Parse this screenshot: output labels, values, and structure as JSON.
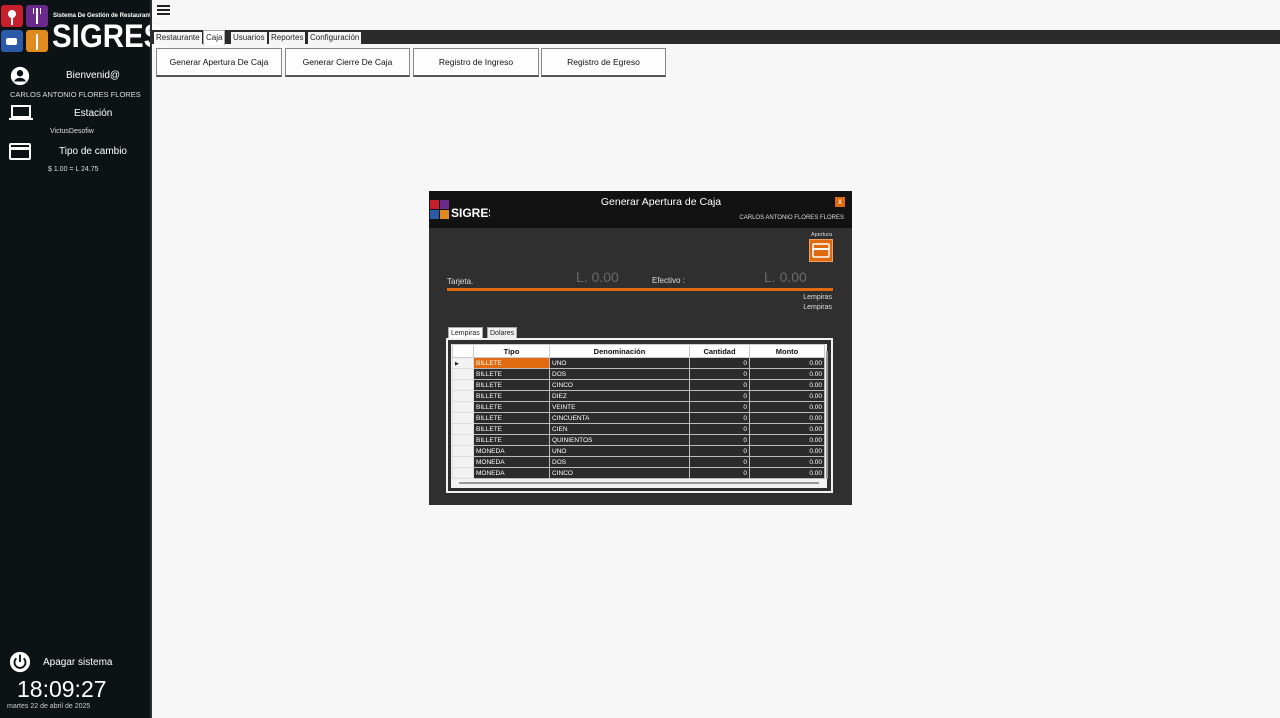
{
  "brand": {
    "name": "SIGRES",
    "tagline": "Sistema De Gestión de Restaurantes"
  },
  "sidebar": {
    "welcome": "Bienvenid@",
    "user": "CARLOS ANTONIO FLORES FLORES",
    "station_label": "Estación",
    "station_value": "VictusDesofiw",
    "exchange_label": "Tipo de cambio",
    "exchange_value": "$ 1.00 = L 24.75",
    "shutdown_label": "Apagar sistema",
    "time": "18:09:27",
    "date": "martes 22 de abril de 2025"
  },
  "menu": {
    "items": [
      "Restaurante",
      "Caja",
      "Usuarios",
      "Reportes",
      "Configuración"
    ],
    "active": "Caja"
  },
  "actions": [
    "Generar Apertura De Caja",
    "Generar Cierre De Caja",
    "Registro de Ingreso",
    "Registro de Egreso"
  ],
  "dialog": {
    "title": "Generar Apertura de Caja",
    "user": "CARLOS ANTONIO FLORES FLORES",
    "close": "x",
    "apertura_label": "Apertura",
    "card_label": "Tarjeta.",
    "card_amount": "L. 0.00",
    "cash_label": "Efectivo :",
    "cash_amount": "L. 0.00",
    "currency_lines": [
      "Lempiras",
      "Lempiras"
    ],
    "tabs": [
      "Lempiras",
      "Dolares"
    ],
    "active_tab": "Lempiras",
    "columns": [
      "Tipo",
      "Denominación",
      "Cantidad",
      "Monto"
    ],
    "rows": [
      {
        "tipo": "BILLETE",
        "denominacion": "UNO",
        "cantidad": "0",
        "monto": "0.00"
      },
      {
        "tipo": "BILLETE",
        "denominacion": "DOS",
        "cantidad": "0",
        "monto": "0.00"
      },
      {
        "tipo": "BILLETE",
        "denominacion": "CINCO",
        "cantidad": "0",
        "monto": "0.00"
      },
      {
        "tipo": "BILLETE",
        "denominacion": "DIEZ",
        "cantidad": "0",
        "monto": "0.00"
      },
      {
        "tipo": "BILLETE",
        "denominacion": "VEINTE",
        "cantidad": "0",
        "monto": "0.00"
      },
      {
        "tipo": "BILLETE",
        "denominacion": "CINCUENTA",
        "cantidad": "0",
        "monto": "0.00"
      },
      {
        "tipo": "BILLETE",
        "denominacion": "CIEN",
        "cantidad": "0",
        "monto": "0.00"
      },
      {
        "tipo": "BILLETE",
        "denominacion": "QUINIENTOS",
        "cantidad": "0",
        "monto": "0.00"
      },
      {
        "tipo": "MONEDA",
        "denominacion": "UNO",
        "cantidad": "0",
        "monto": "0.00"
      },
      {
        "tipo": "MONEDA",
        "denominacion": "DOS",
        "cantidad": "0",
        "monto": "0.00"
      },
      {
        "tipo": "MONEDA",
        "denominacion": "CINCO",
        "cantidad": "0",
        "monto": "0.00"
      }
    ],
    "selected_row": 0
  },
  "colors": {
    "accent": "#e06a10",
    "sidebar": "#0d1315",
    "dialog": "#2f2f2f"
  },
  "icons": [
    "menu-icon",
    "user-circle-icon",
    "laptop-icon",
    "credit-card-icon",
    "power-icon"
  ]
}
